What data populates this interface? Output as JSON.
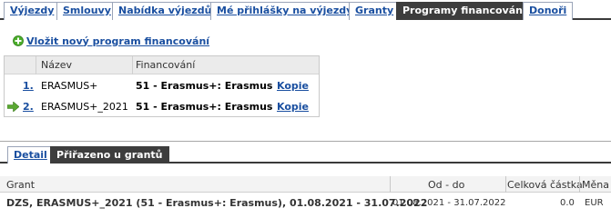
{
  "tabs": [
    {
      "label": "Výjezdy",
      "active": false
    },
    {
      "label": "Smlouvy",
      "active": false
    },
    {
      "label": "Nabídka výjezdů",
      "active": false
    },
    {
      "label": "Mé přihlášky na výjezdy",
      "active": false
    },
    {
      "label": "Granty",
      "active": false
    },
    {
      "label": "Programy financování",
      "active": true
    },
    {
      "label": "Donoři",
      "active": false
    }
  ],
  "insert_label": "Vložit nový program financování",
  "program_table": {
    "headers": {
      "name": "Název",
      "financing": "Financování"
    },
    "rows": [
      {
        "num": "1.",
        "name": "ERASMUS+",
        "financing": "51 - Erasmus+: Erasmus",
        "action": "Kopie",
        "selected": false
      },
      {
        "num": "2.",
        "name": "ERASMUS+_2021",
        "financing": "51 - Erasmus+: Erasmus",
        "action": "Kopie",
        "selected": true
      }
    ]
  },
  "subtabs": [
    {
      "label": "Detail",
      "active": false
    },
    {
      "label": "Přiřazeno u grantů",
      "active": true
    }
  ],
  "grant_table": {
    "headers": {
      "grant": "Grant",
      "period": "Od - do",
      "amount": "Celková částka",
      "currency": "Měna"
    },
    "rows": [
      {
        "grant": "DZS, ERASMUS+_2021 (51 - Erasmus+: Erasmus), 01.08.2021 - 31.07.2022",
        "period": "01.08.2021 - 31.07.2022",
        "amount": "0.0",
        "currency": "EUR"
      }
    ]
  },
  "colors": {
    "link": "#1a4fa0",
    "active_tab": "#3d3d3d",
    "icon_green": "#4caf2a"
  },
  "icons": {
    "insert": "plus-circle-icon",
    "selected_row": "arrow-right-icon"
  }
}
